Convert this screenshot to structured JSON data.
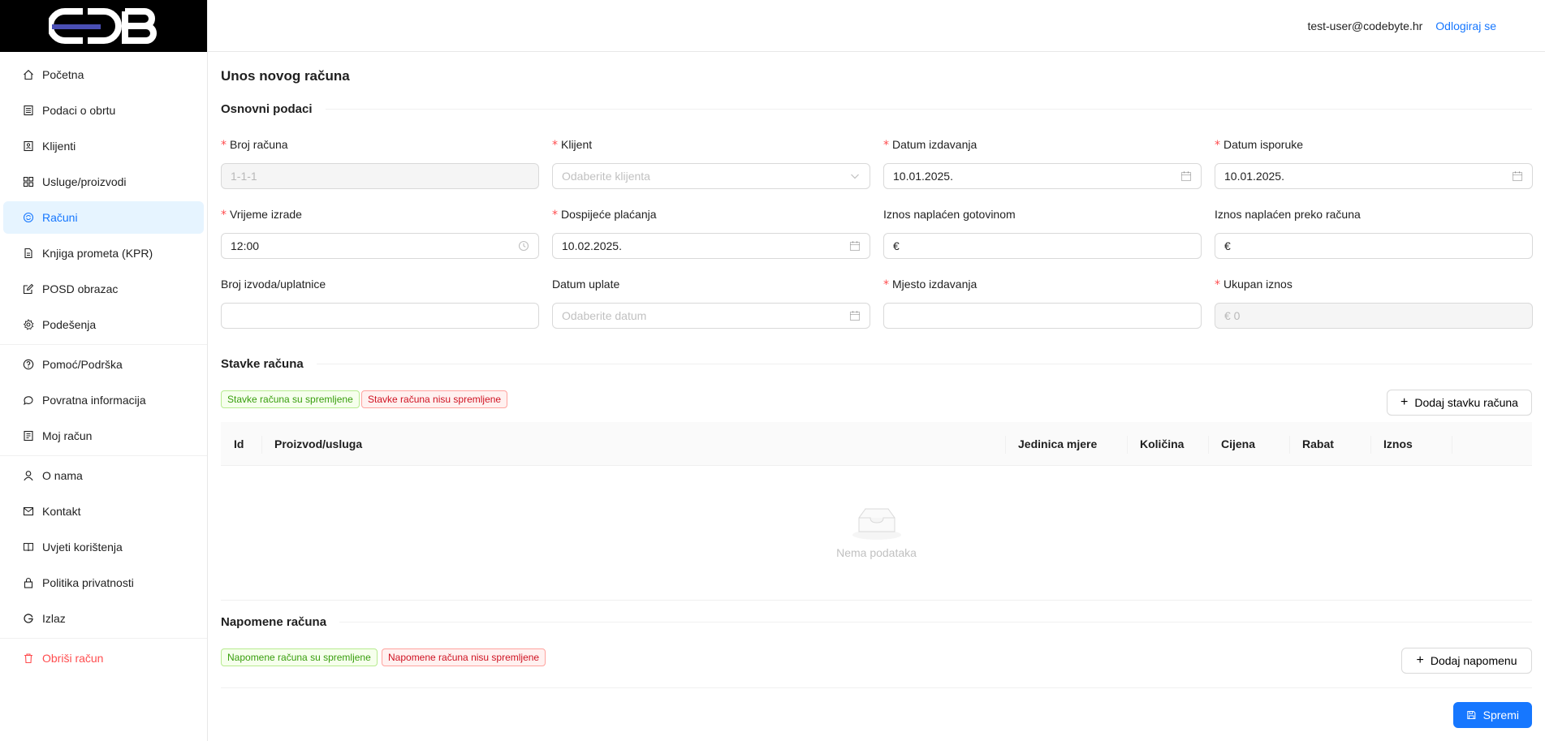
{
  "header": {
    "user_email": "test-user@codebyte.hr",
    "logout_label": "Odlogiraj se"
  },
  "sidebar": {
    "logo_text": "CDB",
    "items": [
      {
        "label": "Početna",
        "icon": "home-icon"
      },
      {
        "label": "Podaci o obrtu",
        "icon": "ledger-icon"
      },
      {
        "label": "Klijenti",
        "icon": "contacts-icon"
      },
      {
        "label": "Usluge/proizvodi",
        "icon": "grid-icon"
      },
      {
        "label": "Računi",
        "icon": "refresh-circle-icon"
      },
      {
        "label": "Knjiga prometa (KPR)",
        "icon": "file-icon"
      },
      {
        "label": "POSD obrazac",
        "icon": "edit-icon"
      },
      {
        "label": "Podešenja",
        "icon": "gear-icon"
      },
      {
        "label": "Pomoć/Podrška",
        "icon": "question-icon"
      },
      {
        "label": "Povratna informacija",
        "icon": "comment-icon"
      },
      {
        "label": "Moj račun",
        "icon": "profile-icon"
      },
      {
        "label": "O nama",
        "icon": "user-icon"
      },
      {
        "label": "Kontakt",
        "icon": "mail-icon"
      },
      {
        "label": "Uvjeti korištenja",
        "icon": "book-icon"
      },
      {
        "label": "Politika privatnosti",
        "icon": "lock-icon"
      },
      {
        "label": "Izlaz",
        "icon": "google-icon"
      },
      {
        "label": "Obriši račun",
        "icon": "trash-icon"
      }
    ],
    "active_item": "Računi"
  },
  "page": {
    "title": "Unos novog računa"
  },
  "basic": {
    "section_title": "Osnovni podaci",
    "broj_racuna": {
      "label": "Broj računa",
      "value": "1-1-1"
    },
    "klijent": {
      "label": "Klijent",
      "placeholder": "Odaberite klijenta"
    },
    "datum_izdavanja": {
      "label": "Datum izdavanja",
      "value": "10.01.2025."
    },
    "datum_isporuke": {
      "label": "Datum isporuke",
      "value": "10.01.2025."
    },
    "vrijeme_izrade": {
      "label": "Vrijeme izrade",
      "value": "12:00"
    },
    "dospijece": {
      "label": "Dospijeće plaćanja",
      "value": "10.02.2025."
    },
    "gotovina": {
      "label": "Iznos naplaćen gotovinom",
      "prefix": "€",
      "value": ""
    },
    "preko_racuna": {
      "label": "Iznos naplaćen preko računa",
      "prefix": "€",
      "value": ""
    },
    "broj_izvoda": {
      "label": "Broj izvoda/uplatnice",
      "value": ""
    },
    "datum_uplate": {
      "label": "Datum uplate",
      "placeholder": "Odaberite datum"
    },
    "mjesto": {
      "label": "Mjesto izdavanja",
      "value": ""
    },
    "ukupan": {
      "label": "Ukupan iznos",
      "value": "€ 0"
    }
  },
  "items": {
    "section_title": "Stavke računa",
    "tag_saved": "Stavke računa su spremljene",
    "tag_unsaved": "Stavke računa nisu spremljene",
    "add_button": "Dodaj stavku računa",
    "columns": [
      "Id",
      "Proizvod/usluga",
      "Jedinica mjere",
      "Količina",
      "Cijena",
      "Rabat",
      "Iznos"
    ],
    "empty_text": "Nema podataka"
  },
  "notes": {
    "section_title": "Napomene računa",
    "tag_saved": "Napomene računa su spremljene",
    "tag_unsaved": "Napomene računa nisu spremljene",
    "add_button": "Dodaj napomenu"
  },
  "footer": {
    "save_button": "Spremi"
  },
  "colors": {
    "primary": "#1677ff",
    "active_bg": "#e6f4ff",
    "danger": "#ff4d4f"
  }
}
